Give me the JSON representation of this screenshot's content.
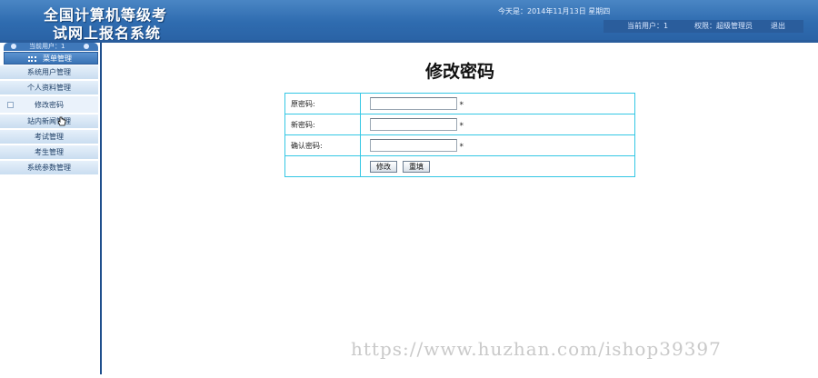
{
  "header": {
    "title_line1": "全国计算机等级考",
    "title_line2": "试网上报名系统",
    "date": "今天是：2014年11月13日 星期四",
    "current_user": "当前用户：1",
    "role": "权限：超级管理员",
    "logout": "退出"
  },
  "sidebar": {
    "top_label": "当前用户：1",
    "menu_title": "菜单管理",
    "items": [
      {
        "label": "系统用户管理"
      },
      {
        "label": "个人资料管理"
      },
      {
        "label": "修改密码"
      },
      {
        "label": "站内新闻管理"
      },
      {
        "label": "考试管理"
      },
      {
        "label": "考生管理"
      },
      {
        "label": "系统参数管理"
      }
    ]
  },
  "main": {
    "title": "修改密码",
    "form": {
      "old_password_label": "原密码:",
      "new_password_label": "新密码:",
      "confirm_password_label": "确认密码:",
      "old_password_value": "",
      "new_password_value": "",
      "confirm_password_value": "",
      "required_mark": "*",
      "submit_label": "修改",
      "reset_label": "重填"
    }
  },
  "watermark": "https://www.huzhan.com/ishop39397",
  "colors": {
    "header_blue": "#2f6cb0",
    "sidebar_border": "#1f4f8d",
    "table_border": "#34c7e4"
  }
}
